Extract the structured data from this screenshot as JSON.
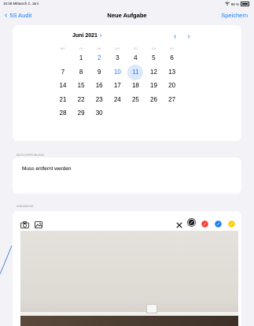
{
  "status_bar": {
    "time": "16:38  Mittwoch 2. Juni",
    "battery": "95 %"
  },
  "nav": {
    "back_label": "5S Audit",
    "title": "Neue Aufgabe",
    "save_label": "Speichern"
  },
  "calendar": {
    "month_label": "Juni 2021",
    "weekdays": [
      "MO",
      "DI",
      "MI",
      "DO",
      "FR",
      "SA",
      "SO"
    ],
    "selected_day": "11",
    "highlight_color": "#1a7cf5",
    "weeks": [
      [
        "",
        "1",
        "2",
        "3",
        "4",
        "5",
        "6"
      ],
      [
        "7",
        "8",
        "9",
        "10",
        "11",
        "12",
        "13"
      ],
      [
        "14",
        "15",
        "16",
        "17",
        "18",
        "19",
        "20"
      ],
      [
        "21",
        "22",
        "23",
        "24",
        "25",
        "26",
        "27"
      ],
      [
        "28",
        "29",
        "30",
        "",
        "",
        "",
        ""
      ]
    ]
  },
  "description": {
    "section_label": "BESCHREIBUNG",
    "text": "Muss entfernt werden"
  },
  "attachments": {
    "section_label": "ANHÄNGE",
    "icons": [
      "camera-icon",
      "photo-library-icon"
    ],
    "drawing_tools": [
      "close-icon",
      "pen-black-icon",
      "pen-red-icon",
      "pen-blue-icon",
      "pen-yellow-icon"
    ],
    "pen_colors": {
      "black": "#1c1c1e",
      "red": "#ff3b30",
      "blue": "#1a7cf5",
      "yellow": "#ffcc00"
    }
  }
}
